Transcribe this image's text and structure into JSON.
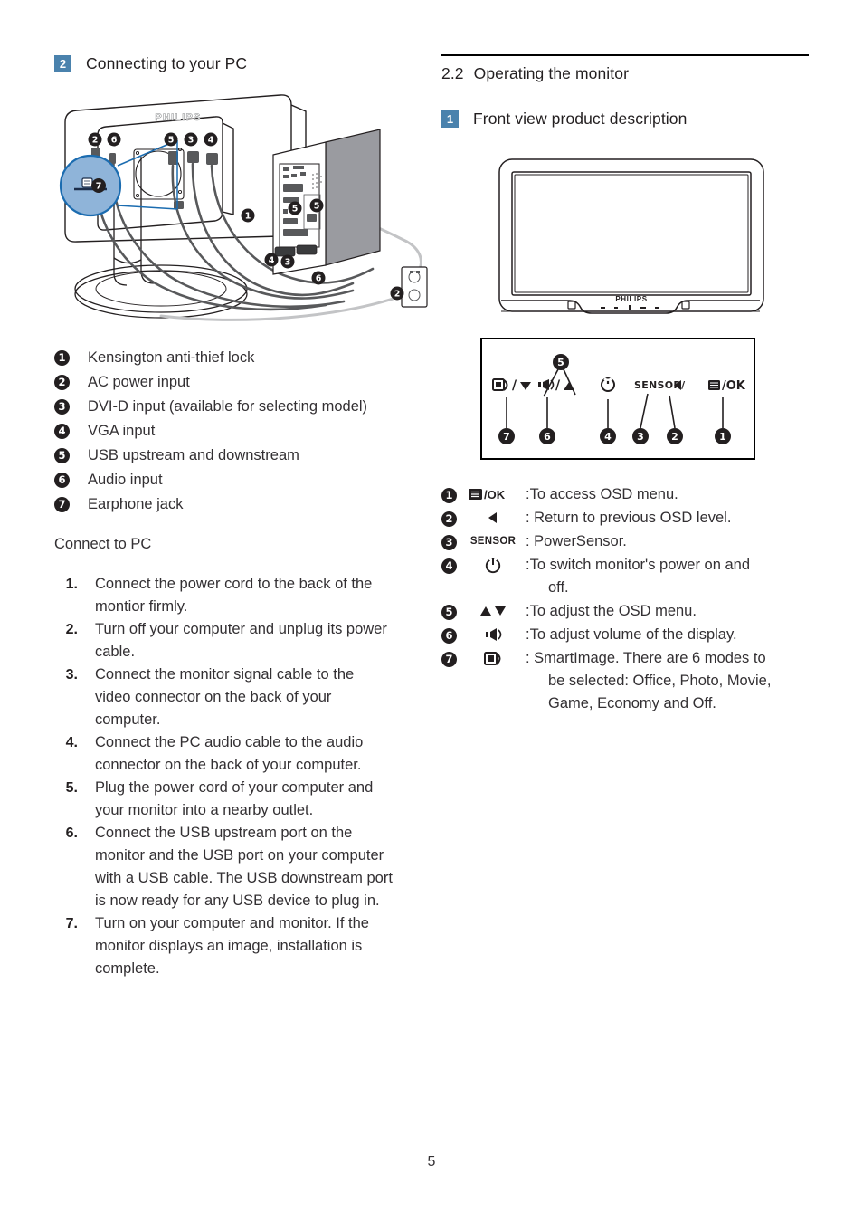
{
  "page": {
    "number": "5"
  },
  "left": {
    "section": {
      "badge": "2",
      "title": "Connecting to your PC"
    },
    "figure_back": {
      "name": "monitor-rear-connection-diagram",
      "brand_label": "PHILIPS",
      "callout_markers": [
        "1",
        "2",
        "3",
        "4",
        "5",
        "6",
        "7"
      ]
    },
    "ports": [
      {
        "num": "1",
        "label": "Kensington anti-thief lock"
      },
      {
        "num": "2",
        "label": "AC power input"
      },
      {
        "num": "3",
        "label": "DVI-D input (available for selecting model)"
      },
      {
        "num": "4",
        "label": "VGA input"
      },
      {
        "num": "5",
        "label": "USB upstream and downstream"
      },
      {
        "num": "6",
        "label": "Audio input"
      },
      {
        "num": "7",
        "label": "Earphone jack"
      }
    ],
    "connect_heading": "Connect to PC",
    "steps": [
      {
        "num": "1.",
        "text": "Connect the power cord to the back of the montior firmly."
      },
      {
        "num": "2.",
        "text": "Turn off your computer and unplug its power cable."
      },
      {
        "num": "3.",
        "text": "Connect the monitor signal cable to the video connector on the back of your computer."
      },
      {
        "num": "4.",
        "text": "Connect the PC audio cable to the audio connector on the back of your computer."
      },
      {
        "num": "5.",
        "text": "Plug the power cord of your computer and your monitor into a nearby outlet."
      },
      {
        "num": "6.",
        "text": "Connect the USB upstream port on the monitor and the USB port on your computer with a USB cable. The USB downstream port is now ready for any USB device to plug in."
      },
      {
        "num": "7.",
        "text": "Turn on your computer and monitor. If the monitor displays an image, installation is complete."
      }
    ]
  },
  "right": {
    "section": {
      "number": "2.2",
      "title": "Operating the monitor"
    },
    "subsection": {
      "badge": "1",
      "title": "Front view product description"
    },
    "figure_front": {
      "name": "monitor-front-view",
      "brand_label": "PHILIPS"
    },
    "panel": {
      "name": "front-control-panel-diagram",
      "group_marker": "5",
      "buttons": [
        {
          "marker": "7",
          "glyph": "smartimage",
          "label": "/▼"
        },
        {
          "marker": "6",
          "glyph": "volume",
          "label": "/▲"
        },
        {
          "marker": "4",
          "glyph": "power",
          "label": ""
        },
        {
          "marker": "3",
          "glyph": "sensor",
          "label": "SENSOR/◀"
        },
        {
          "marker": "2",
          "glyph": "left-arrow",
          "label": ""
        },
        {
          "marker": "1",
          "glyph": "menu",
          "label": "/OK"
        }
      ]
    },
    "legend": [
      {
        "num": "1",
        "icon": "menu-ok",
        "icon_text": "/OK",
        "desc": ":To access OSD menu.",
        "cont": ""
      },
      {
        "num": "2",
        "icon": "left-arrow",
        "icon_text": "◀",
        "desc": ": Return to previous OSD level.",
        "cont": ""
      },
      {
        "num": "3",
        "icon": "sensor",
        "icon_text": "SENSOR",
        "desc": ": PowerSensor.",
        "cont": ""
      },
      {
        "num": "4",
        "icon": "power",
        "icon_text": "",
        "desc": ":To switch monitor's power on and",
        "cont": "off."
      },
      {
        "num": "5",
        "icon": "up-down-arrows",
        "icon_text": "▲▼",
        "desc": ":To adjust the OSD menu.",
        "cont": ""
      },
      {
        "num": "6",
        "icon": "volume",
        "icon_text": "",
        "desc": ":To adjust volume of the display.",
        "cont": ""
      },
      {
        "num": "7",
        "icon": "smartimage",
        "icon_text": "",
        "desc": ": SmartImage. There are 6 modes to",
        "cont": "be selected: Office, Photo, Movie, Game, Economy and Off."
      }
    ]
  },
  "colors": {
    "badge_blue": "#4a82ad",
    "callout_black": "#231f20",
    "magnifier_fill": "#8fb4d9",
    "magnifier_stroke": "#1b6cb0",
    "tower_grey": "#9a9ba0",
    "line_grey": "#58595b"
  }
}
